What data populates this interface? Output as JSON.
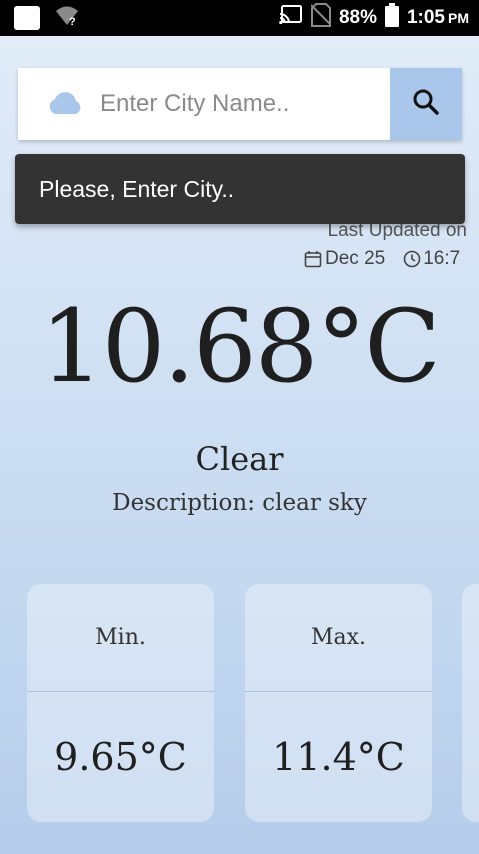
{
  "status_bar": {
    "battery": "88%",
    "time": "1:05",
    "ampm": "PM"
  },
  "search": {
    "placeholder": "Enter City Name.."
  },
  "toast": {
    "message": "Please, Enter City.."
  },
  "updated": {
    "label": "Last Updated on",
    "date": "Dec 25",
    "time": "16:7"
  },
  "weather": {
    "temperature": "10.68°C",
    "condition": "Clear",
    "description": "Description: clear sky"
  },
  "cards": [
    {
      "label": "Min.",
      "value": "9.65°C"
    },
    {
      "label": "Max.",
      "value": "11.4°C"
    }
  ],
  "colors": {
    "accent": "#a9c7ea",
    "toast_bg": "#333333"
  }
}
